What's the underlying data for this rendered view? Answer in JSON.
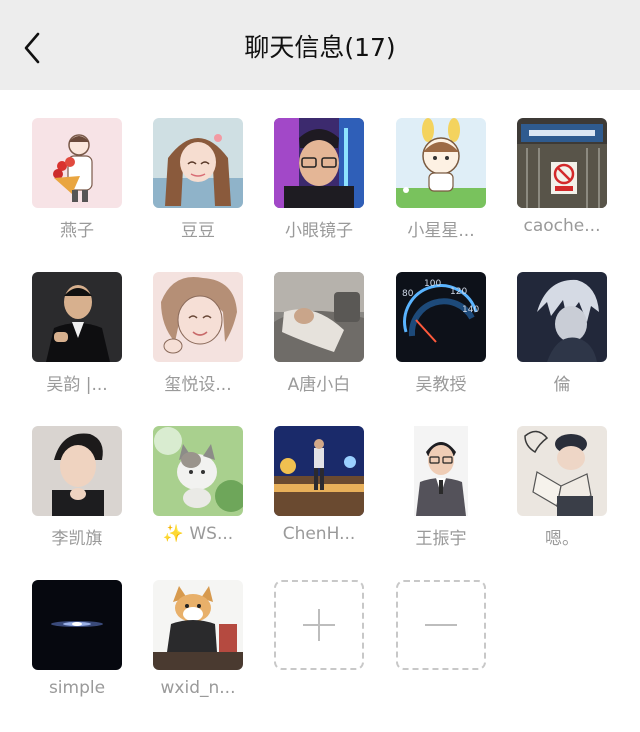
{
  "header": {
    "title": "聊天信息(17)",
    "background": "#ededed"
  },
  "members": [
    {
      "name": "燕子",
      "avatar": "cartoon-girl-with-flowers"
    },
    {
      "name": "豆豆",
      "avatar": "anime-girl-braids"
    },
    {
      "name": "小眼镜子",
      "avatar": "boy-with-glasses"
    },
    {
      "name": "小星星...",
      "avatar": "cartoon-bunny-girl"
    },
    {
      "name": "caoche...",
      "avatar": "street-sign-photo"
    },
    {
      "name": "吴韵 |...",
      "avatar": "man-in-suit"
    },
    {
      "name": "玺悦设...",
      "avatar": "drawn-curly-hair-girl"
    },
    {
      "name": "A唐小白",
      "avatar": "person-resting"
    },
    {
      "name": "吴教授",
      "avatar": "car-speedometer"
    },
    {
      "name": "倫",
      "avatar": "anime-white-hair"
    },
    {
      "name": "李凯旗",
      "avatar": "young-man-portrait"
    },
    {
      "name": "✨ WS...",
      "avatar": "kitten-in-grass"
    },
    {
      "name": "ChenH...",
      "avatar": "night-city-person"
    },
    {
      "name": "王振宇",
      "avatar": "man-with-glasses-suit"
    },
    {
      "name": "嗯。",
      "avatar": "drawn-boy-reading"
    },
    {
      "name": "simple",
      "avatar": "light-in-darkness"
    },
    {
      "name": "wxid_n...",
      "avatar": "dog-in-clothes"
    }
  ],
  "actions": {
    "add_icon": "plus-icon",
    "remove_icon": "minus-icon"
  }
}
